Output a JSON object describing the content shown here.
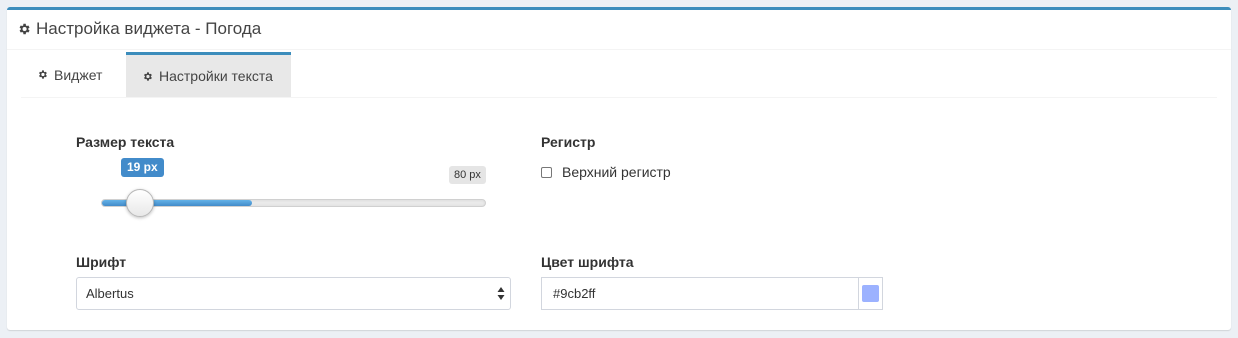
{
  "header": {
    "title": "Настройка виджета - Погода",
    "icon": "gear-icon"
  },
  "tabs": [
    {
      "label": "Виджет",
      "icon": "gear-icon",
      "active": false
    },
    {
      "label": "Настройки текста",
      "icon": "gear-icon",
      "active": true
    }
  ],
  "text_size": {
    "label": "Размер текста",
    "value_label": "19 px",
    "max_label": "80 px",
    "value": 19,
    "max": 80
  },
  "register": {
    "label": "Регистр",
    "checkbox_label": "Верхний регистр",
    "checked": false
  },
  "font": {
    "label": "Шрифт",
    "selected": "Albertus"
  },
  "font_color": {
    "label": "Цвет шрифта",
    "value": "#9cb2ff",
    "swatch_color": "#9cb2ff"
  },
  "colors": {
    "accent": "#3c8dbc",
    "slider_fill": "#428bca"
  }
}
